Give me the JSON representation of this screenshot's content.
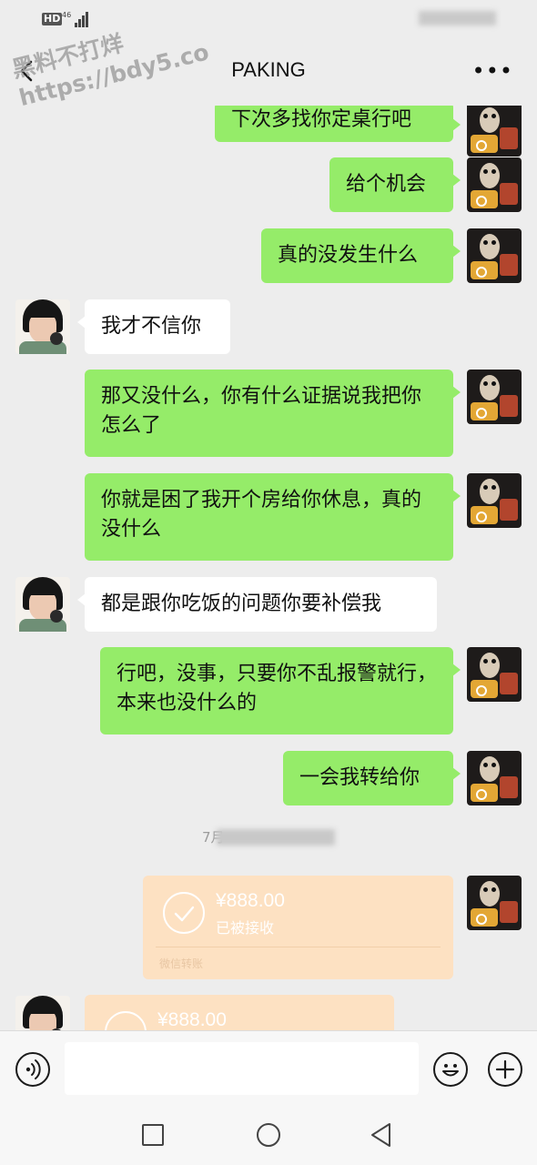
{
  "header": {
    "title": "PAKING"
  },
  "watermark": {
    "line1": "黑料不打烊",
    "line2": "https://bdy5.co"
  },
  "status": {
    "hd": "HD",
    "network": "46"
  },
  "messages": [
    {
      "from": "me",
      "text": "下次多找你定桌行吧"
    },
    {
      "from": "me",
      "text": "给个机会"
    },
    {
      "from": "me",
      "text": "真的没发生什么"
    },
    {
      "from": "her",
      "text": "我才不信你"
    },
    {
      "from": "me",
      "text": "那又没什么，你有什么证据说我把你怎么了"
    },
    {
      "from": "me",
      "text": "你就是困了我开个房给你休息，真的没什么"
    },
    {
      "from": "her",
      "text": "都是跟你吃饭的问题你要补偿我"
    },
    {
      "from": "me",
      "text": "行吧，没事，只要你不乱报警就行，本来也没什么的"
    },
    {
      "from": "me",
      "text": "一会我转给你"
    }
  ],
  "timestamp": {
    "prefix": "7月"
  },
  "transfers": [
    {
      "from": "me",
      "amount": "¥888.00",
      "status": "已被接收",
      "footer": "微信转账"
    },
    {
      "from": "her",
      "amount": "¥888.00"
    }
  ],
  "icons": {
    "voice": "voice-icon",
    "emoji": "emoji-icon",
    "plus": "plus-icon",
    "back": "back-arrow-icon",
    "more": "more-icon"
  },
  "colors": {
    "bubble_me": "#95ec69",
    "bubble_her": "#ffffff",
    "background": "#ededed",
    "transfer": "#fde1c2"
  }
}
